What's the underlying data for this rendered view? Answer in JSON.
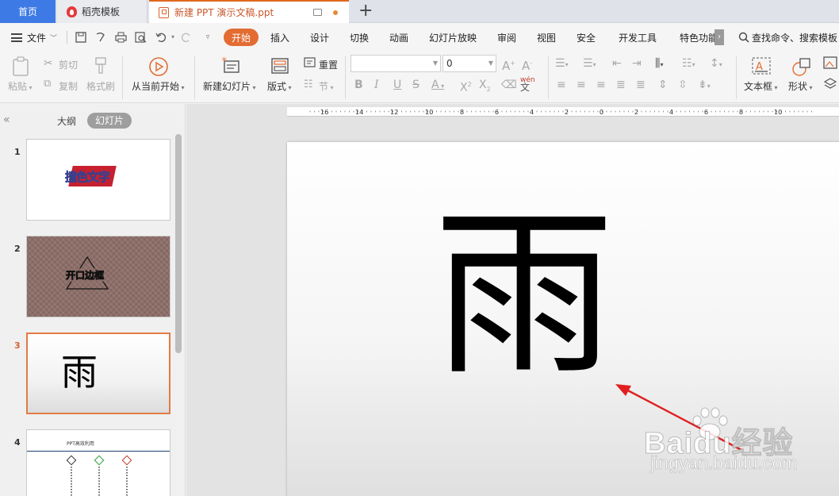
{
  "tabs": {
    "home": "首页",
    "template": "稻壳模板",
    "document": "新建 PPT 演示文稿.ppt"
  },
  "menu": {
    "file": "文件",
    "items": [
      "开始",
      "插入",
      "设计",
      "切换",
      "动画",
      "幻灯片放映",
      "审阅",
      "视图",
      "安全",
      "开发工具",
      "特色功能"
    ],
    "active": "开始",
    "search": "查找命令、搜索模板"
  },
  "ribbon": {
    "paste": "粘贴",
    "cut": "剪切",
    "copy": "复制",
    "format_painter": "格式刷",
    "play_from_current": "从当前开始",
    "new_slide": "新建幻灯片",
    "layout": "版式",
    "reset": "重置",
    "section": "节",
    "font_name": "",
    "font_size": "0",
    "text_box": "文本框",
    "shape": "形状",
    "phonetic": "wén"
  },
  "left_panel": {
    "outline": "大纲",
    "slides": "幻灯片",
    "slide_numbers": [
      "1",
      "2",
      "3",
      "4"
    ],
    "thumb1_text": "撞色文字",
    "thumb2_text": "开口边框",
    "thumb3_text": "雨",
    "thumb4_title": "PPT高效利用"
  },
  "ruler": {
    "labels": [
      "16",
      "14",
      "12",
      "10",
      "8",
      "6",
      "4",
      "2",
      "0",
      "2",
      "4",
      "6",
      "8",
      "10"
    ]
  },
  "slide": {
    "main_text": "雨"
  },
  "watermark": {
    "brand": "Baidu经验",
    "url": "jingyan.baidu.com"
  },
  "colors": {
    "accent": "#e36c32",
    "home_tab": "#3d7ae5",
    "annotation_arrow": "#e02020"
  }
}
